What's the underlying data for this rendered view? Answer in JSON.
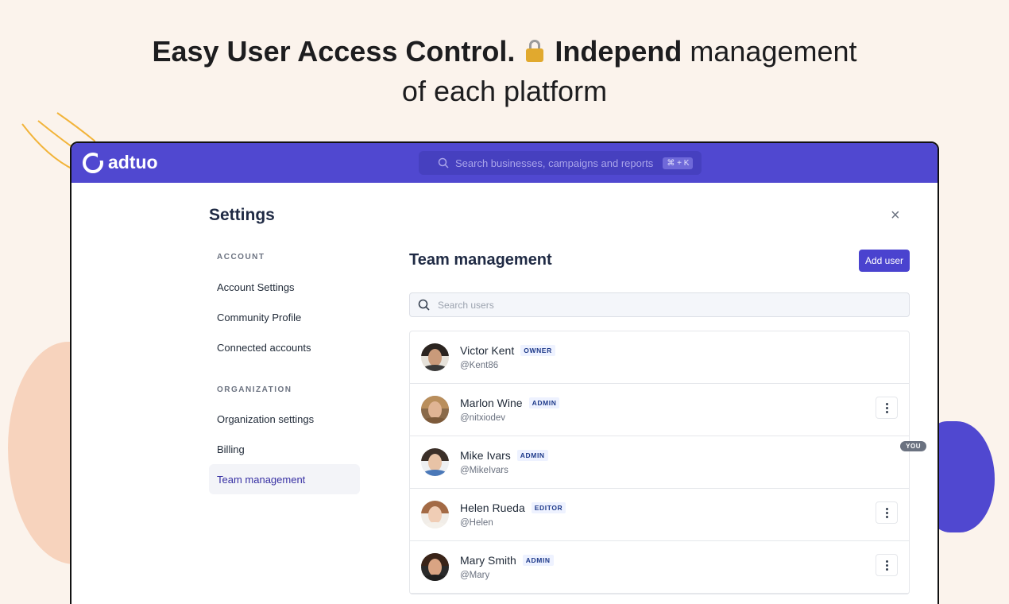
{
  "headline": {
    "part1": "Easy User Access Control.",
    "part2": "Independ",
    "part3": "management",
    "line2": "of each platform"
  },
  "app": {
    "logo": "adtuo",
    "search_placeholder": "Search businesses, campaigns and reports",
    "search_shortcut": "⌘ + K",
    "accent": "#5048d0"
  },
  "settings": {
    "title": "Settings",
    "close_icon": "×",
    "nav": {
      "account_section": "ACCOUNT",
      "account_items": [
        "Account Settings",
        "Community Profile",
        "Connected accounts"
      ],
      "org_section": "ORGANIZATION",
      "org_items": [
        "Organization settings",
        "Billing",
        "Team management"
      ],
      "active": "Team management"
    }
  },
  "team": {
    "title": "Team management",
    "add_user_label": "Add user",
    "search_placeholder": "Search users",
    "you_badge": "YOU",
    "users": [
      {
        "name": "Victor Kent",
        "role": "OWNER",
        "handle": "@Kent86",
        "menu": false
      },
      {
        "name": "Marlon Wine",
        "role": "ADMIN",
        "handle": "@nitxiodev",
        "menu": true
      },
      {
        "name": "Mike Ivars",
        "role": "ADMIN",
        "handle": "@MikeIvars",
        "menu": false
      },
      {
        "name": "Helen Rueda",
        "role": "EDITOR",
        "handle": "@Helen",
        "menu": true
      },
      {
        "name": "Mary Smith",
        "role": "ADMIN",
        "handle": "@Mary",
        "menu": true
      }
    ]
  }
}
